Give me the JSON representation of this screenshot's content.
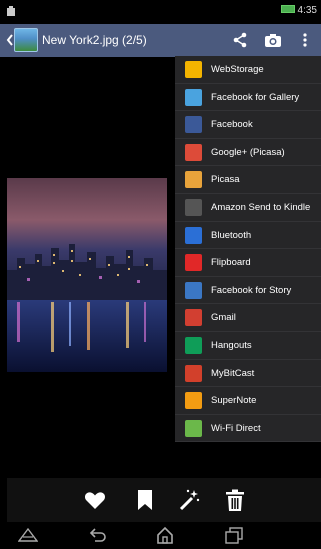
{
  "status_bar": {
    "time": "4:35"
  },
  "action_bar": {
    "title": "New York2.jpg (2/5)"
  },
  "share_menu": [
    {
      "label": "WebStorage",
      "icon": "webstorage-icon",
      "color": "#f4b400"
    },
    {
      "label": "Facebook for Gallery",
      "icon": "gallery-icon",
      "color": "#4aa3df"
    },
    {
      "label": "Facebook",
      "icon": "facebook-icon",
      "color": "#3b5998"
    },
    {
      "label": "Google+ (Picasa)",
      "icon": "google-plus-icon",
      "color": "#dd4b39"
    },
    {
      "label": "Picasa",
      "icon": "picasa-icon",
      "color": "#e8a33b"
    },
    {
      "label": "Amazon Send to Kindle",
      "icon": "kindle-icon",
      "color": "#555555"
    },
    {
      "label": "Bluetooth",
      "icon": "bluetooth-icon",
      "color": "#2b6fd6"
    },
    {
      "label": "Flipboard",
      "icon": "flipboard-icon",
      "color": "#e12828"
    },
    {
      "label": "Facebook for Story",
      "icon": "story-icon",
      "color": "#3b77c4"
    },
    {
      "label": "Gmail",
      "icon": "gmail-icon",
      "color": "#d23f31"
    },
    {
      "label": "Hangouts",
      "icon": "hangouts-icon",
      "color": "#0f9d58"
    },
    {
      "label": "MyBitCast",
      "icon": "mybitcast-icon",
      "color": "#d2402b"
    },
    {
      "label": "SuperNote",
      "icon": "supernote-icon",
      "color": "#f39c12"
    },
    {
      "label": "Wi-Fi Direct",
      "icon": "wifi-direct-icon",
      "color": "#6bb84a"
    }
  ],
  "bottom_toolbar": {
    "favorite": "heart-icon",
    "bookmark": "bookmark-icon",
    "edit": "magic-wand-icon",
    "delete": "trash-icon"
  }
}
